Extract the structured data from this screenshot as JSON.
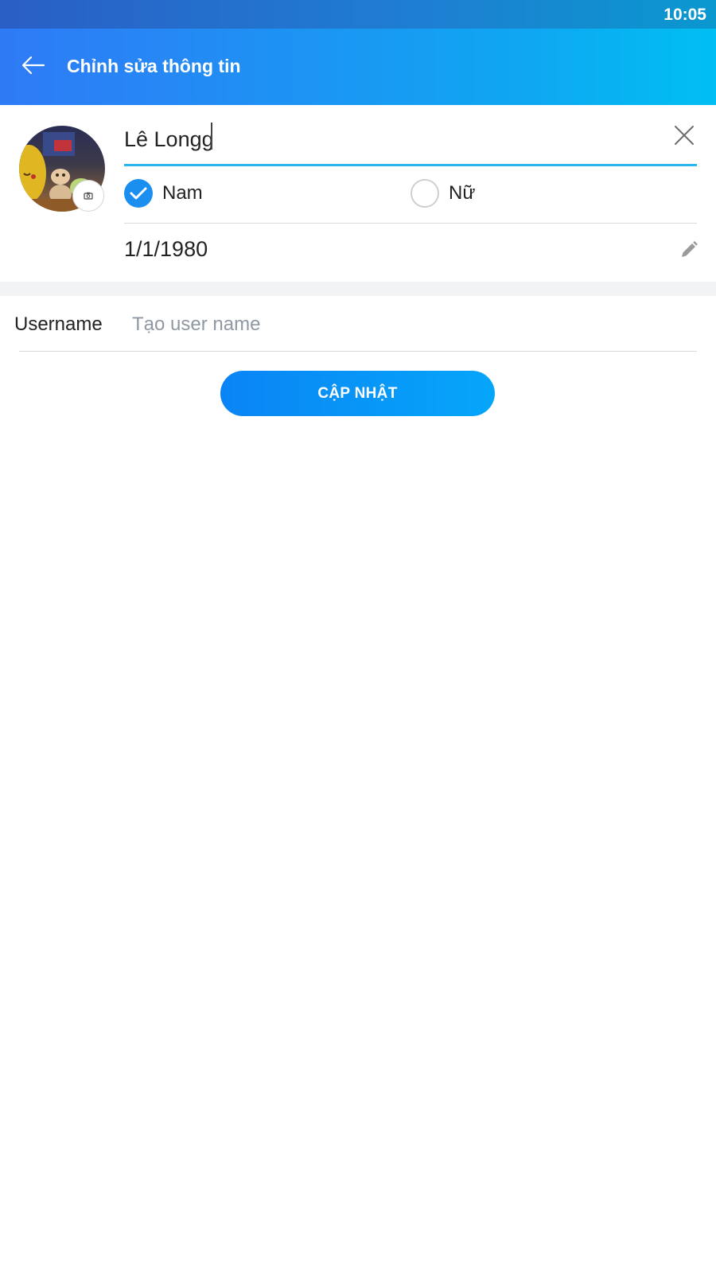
{
  "status_bar": {
    "time": "10:05"
  },
  "app_bar": {
    "title": "Chỉnh sửa thông tin",
    "back_icon": "arrow-left-icon"
  },
  "profile": {
    "avatar_icon": "avatar-photo",
    "camera_icon": "camera-icon",
    "name_value": "Lê Longg",
    "clear_icon": "close-icon",
    "gender_options": [
      {
        "label": "Nam",
        "selected": true
      },
      {
        "label": "Nữ",
        "selected": false
      }
    ],
    "dob": "1/1/1980",
    "edit_icon": "pencil-icon"
  },
  "username": {
    "label": "Username",
    "value": "",
    "placeholder": "Tạo user name"
  },
  "update_button": {
    "label": "CẬP NHẬT"
  },
  "colors": {
    "accent": "#1a8ff0",
    "underline": "#2ab6ea",
    "header_start": "#2f7af6",
    "header_end": "#00bff2"
  }
}
